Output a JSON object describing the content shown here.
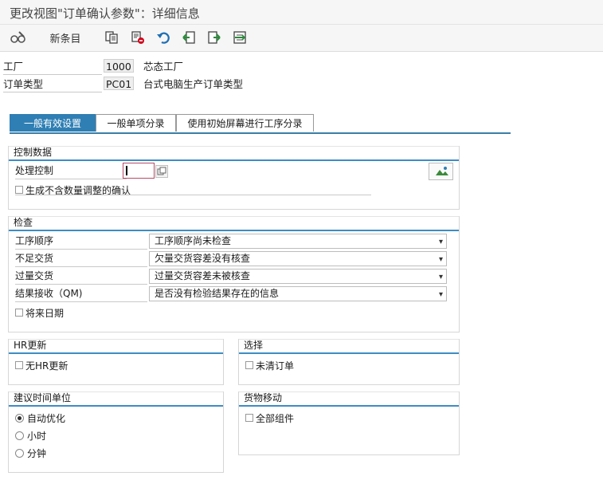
{
  "window": {
    "title": "更改视图\"订单确认参数\"：详细信息"
  },
  "toolbar": {
    "new_entries_label": "新条目",
    "icons": [
      "glasses-edit-icon",
      "copy-icon",
      "delete-icon",
      "undo-icon",
      "prev-entry-icon",
      "next-entry-icon",
      "select-block-icon"
    ]
  },
  "header": {
    "plant_label": "工厂",
    "plant_value": "1000",
    "plant_desc": "芯态工厂",
    "order_type_label": "订单类型",
    "order_type_value": "PC01",
    "order_type_desc": "台式电脑生产订单类型"
  },
  "tabs": [
    {
      "label": "一般有效设置",
      "active": true
    },
    {
      "label": "一般单项分录",
      "active": false
    },
    {
      "label": "使用初始屏幕进行工序分录",
      "active": false
    }
  ],
  "control_data": {
    "title": "控制数据",
    "processing_control_label": "处理控制",
    "processing_control_value": "",
    "checkbox_label": "生成不含数量调整的确认"
  },
  "checks": {
    "title": "检查",
    "rows": [
      {
        "label": "工序顺序",
        "value": "工序顺序尚未检查"
      },
      {
        "label": "不足交货",
        "value": "欠量交货容差没有核查"
      },
      {
        "label": "过量交货",
        "value": "过量交货容差未被核查"
      },
      {
        "label": "结果接收（QM)",
        "value": "是否没有检验结果存在的信息"
      }
    ],
    "future_date_label": "将来日期"
  },
  "hr_update": {
    "title": "HR更新",
    "checkbox_label": "无HR更新"
  },
  "selection": {
    "title": "选择",
    "checkbox_label": "未清订单"
  },
  "time_unit": {
    "title": "建议时间单位",
    "options": [
      {
        "label": "自动优化",
        "selected": true
      },
      {
        "label": "小时",
        "selected": false
      },
      {
        "label": "分钟",
        "selected": false
      }
    ]
  },
  "goods_movement": {
    "title": "货物移动",
    "checkbox_label": "全部组件"
  },
  "colors": {
    "accent": "#2f7fb4",
    "group_line": "#3e8cc4"
  }
}
